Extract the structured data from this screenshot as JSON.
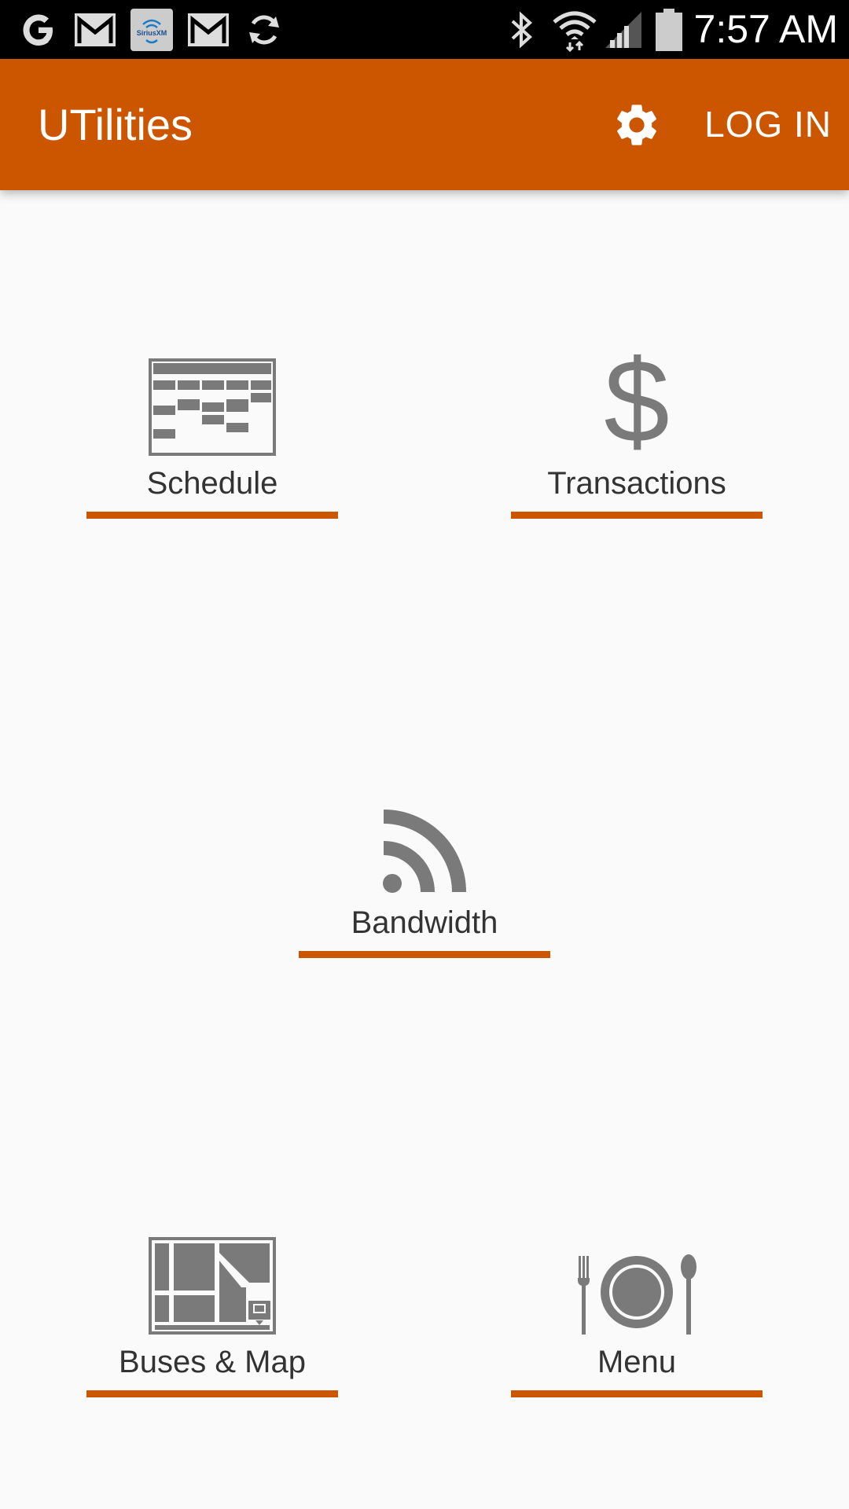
{
  "status_bar": {
    "time": "7:57 AM",
    "left_icons": [
      "google-icon",
      "gmail-icon",
      "siriusxm-icon",
      "gmail-icon",
      "sync-icon"
    ],
    "right_icons": [
      "bluetooth-icon",
      "wifi-icon",
      "signal-icon",
      "battery-icon"
    ],
    "siriusxm_text": "SiriusXM"
  },
  "app_bar": {
    "title": "UTilities",
    "settings_icon": "gear-icon",
    "login_label": "LOG IN",
    "color": "#cc5500"
  },
  "tiles": [
    {
      "label": "Schedule",
      "icon": "calendar-grid-icon"
    },
    {
      "label": "Transactions",
      "icon": "dollar-icon"
    },
    {
      "label": "Bandwidth",
      "icon": "rss-feed-icon"
    },
    {
      "label": "Buses & Map",
      "icon": "map-icon"
    },
    {
      "label": "Menu",
      "icon": "plate-cutlery-icon"
    }
  ],
  "colors": {
    "accent": "#cc5500",
    "icon_gray": "#7a7a7a",
    "background": "#fafafa",
    "status_bar": "#000000"
  }
}
